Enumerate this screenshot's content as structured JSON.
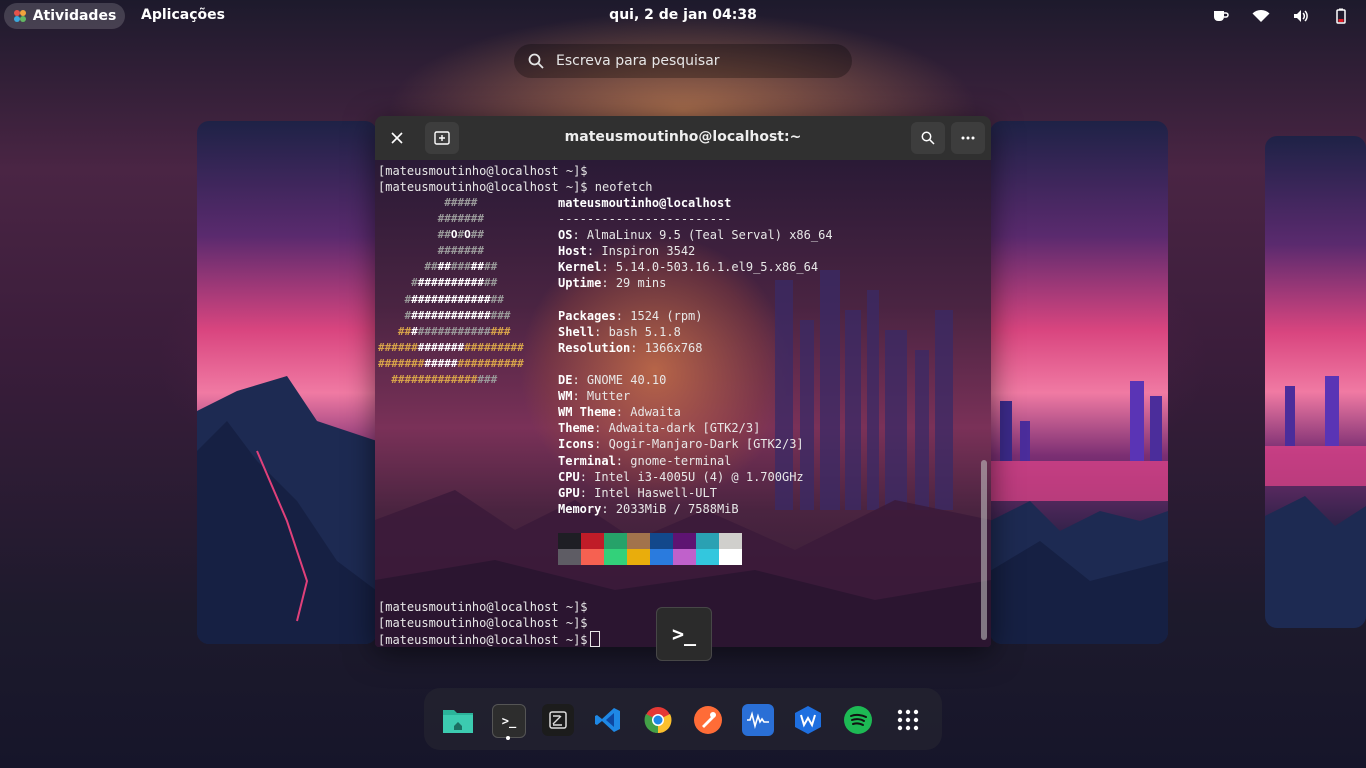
{
  "topbar": {
    "activities_label": "Atividades",
    "applications_label": "Aplicações",
    "clock": "qui, 2 de jan  04:38",
    "tray_icons": [
      "coffee-icon",
      "wifi-icon",
      "volume-icon",
      "battery-icon"
    ]
  },
  "search": {
    "placeholder": "Escreva para pesquisar"
  },
  "terminal": {
    "title": "mateusmoutinho@localhost:~",
    "buttons": [
      "close-icon",
      "new-tab-icon",
      "search-icon",
      "menu-icon"
    ],
    "prompt_lines_top": [
      "[mateusmoutinho@localhost ~]$",
      "[mateusmoutinho@localhost ~]$ neofetch"
    ],
    "user_host": "mateusmoutinho@localhost",
    "separator": "------------------------",
    "info": [
      {
        "key": "OS",
        "value": "AlmaLinux 9.5 (Teal Serval) x86_64"
      },
      {
        "key": "Host",
        "value": "Inspiron 3542"
      },
      {
        "key": "Kernel",
        "value": "5.14.0-503.16.1.el9_5.x86_64"
      },
      {
        "key": "Uptime",
        "value": "29 mins"
      },
      {
        "key": "",
        "value": ""
      },
      {
        "key": "Packages",
        "value": "1524 (rpm)"
      },
      {
        "key": "Shell",
        "value": "bash 5.1.8"
      },
      {
        "key": "Resolution",
        "value": "1366x768"
      },
      {
        "key": "",
        "value": ""
      },
      {
        "key": "DE",
        "value": "GNOME 40.10"
      },
      {
        "key": "WM",
        "value": "Mutter"
      },
      {
        "key": "WM Theme",
        "value": "Adwaita"
      },
      {
        "key": "Theme",
        "value": "Adwaita-dark [GTK2/3]"
      },
      {
        "key": "Icons",
        "value": "Qogir-Manjaro-Dark [GTK2/3]"
      },
      {
        "key": "Terminal",
        "value": "gnome-terminal"
      },
      {
        "key": "CPU",
        "value": "Intel i3-4005U (4) @ 1.700GHz"
      },
      {
        "key": "GPU",
        "value": "Intel Haswell-ULT"
      },
      {
        "key": "Memory",
        "value": "2033MiB / 7588MiB"
      }
    ],
    "palette_top": [
      "#1e1e24",
      "#c01c28",
      "#26a269",
      "#a2734c",
      "#12488b",
      "#5e1472",
      "#2aa1b3",
      "#d0cfcc"
    ],
    "palette_bottom": [
      "#5e5c64",
      "#f66151",
      "#33d17a",
      "#e9ad0c",
      "#2a7bde",
      "#c061cb",
      "#33c7de",
      "#ffffff"
    ],
    "prompt_lines_bottom": [
      "[mateusmoutinho@localhost ~]$",
      "[mateusmoutinho@localhost ~]$",
      "[mateusmoutinho@localhost ~]$"
    ],
    "badge_glyph": ">_"
  },
  "dock": {
    "items": [
      "files-icon",
      "terminal-icon",
      "text-editor-icon",
      "vscode-icon",
      "chrome-icon",
      "postman-icon",
      "audio-editor-icon",
      "wps-office-icon",
      "spotify-icon",
      "app-grid-icon"
    ],
    "terminal_glyph": ">_"
  }
}
